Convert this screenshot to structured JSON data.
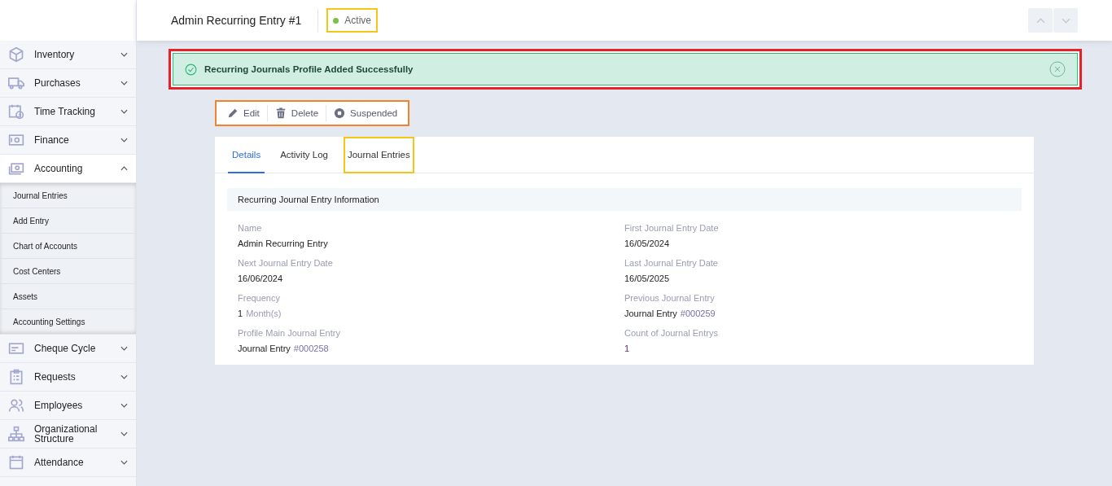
{
  "sidebar": {
    "items": [
      {
        "label": "Inventory",
        "expanded": false
      },
      {
        "label": "Purchases",
        "expanded": false
      },
      {
        "label": "Time Tracking",
        "expanded": false
      },
      {
        "label": "Finance",
        "expanded": false
      },
      {
        "label": "Accounting",
        "expanded": true,
        "children": [
          {
            "label": "Journal Entries"
          },
          {
            "label": "Add Entry"
          },
          {
            "label": "Chart of Accounts"
          },
          {
            "label": "Cost Centers"
          },
          {
            "label": "Assets"
          },
          {
            "label": "Accounting Settings"
          }
        ]
      },
      {
        "label": "Cheque Cycle",
        "expanded": false
      },
      {
        "label": "Requests",
        "expanded": false
      },
      {
        "label": "Employees",
        "expanded": false
      },
      {
        "label": "Organizational Structure",
        "expanded": false
      },
      {
        "label": "Attendance",
        "expanded": false
      }
    ]
  },
  "header": {
    "title": "Admin Recurring Entry #1",
    "status": {
      "label": "Active",
      "color": "#7ac143",
      "highlighted": true
    }
  },
  "alert": {
    "message": "Recurring Journals Profile Added Successfully",
    "highlighted": true
  },
  "actions": {
    "highlighted": true,
    "buttons": [
      {
        "label": "Edit"
      },
      {
        "label": "Delete"
      },
      {
        "label": "Suspended"
      }
    ]
  },
  "tabs": [
    {
      "label": "Details",
      "selected": true,
      "highlighted": false
    },
    {
      "label": "Activity Log",
      "selected": false,
      "highlighted": false
    },
    {
      "label": "Journal Entries",
      "selected": false,
      "highlighted": true
    }
  ],
  "section": {
    "title": "Recurring Journal Entry Information",
    "fields": [
      {
        "label": "Name",
        "value": "Admin Recurring Entry"
      },
      {
        "label": "First Journal Entry Date",
        "value": "16/05/2024"
      },
      {
        "label": "Next Journal Entry Date",
        "value": "16/06/2024"
      },
      {
        "label": "Last Journal Entry Date",
        "value": "16/05/2025"
      },
      {
        "label": "Frequency",
        "value": "1",
        "suffix": "Month(s)"
      },
      {
        "label": "Previous Journal Entry",
        "value": "Journal Entry",
        "link": "#000259"
      },
      {
        "label": "Profile Main Journal Entry",
        "value": "Journal Entry",
        "link": "#000258"
      },
      {
        "label": "Count of Journal Entrys",
        "value": "1",
        "kind": "count"
      }
    ]
  }
}
